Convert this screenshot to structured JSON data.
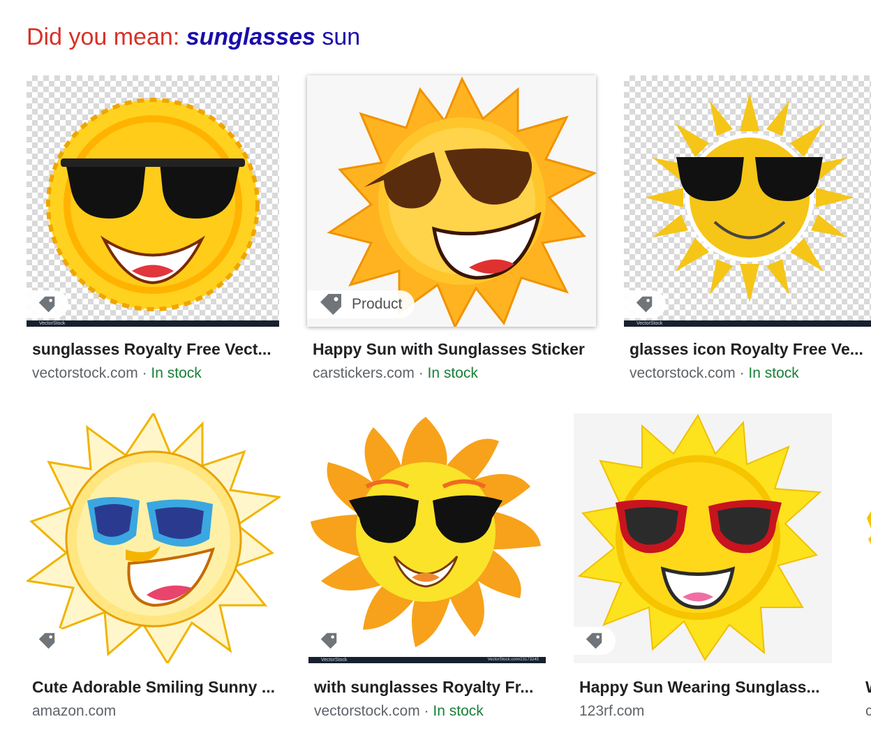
{
  "did_you_mean": {
    "label": "Did you mean:",
    "suggestion_strong": "sunglasses",
    "suggestion_rest": "sun"
  },
  "cards": [
    {
      "title": "sunglasses Royalty Free Vect...",
      "source": "vectorstock.com",
      "separator": "·",
      "stock": "In stock",
      "watermark": "VectorStock"
    },
    {
      "title": "Happy Sun with Sunglasses Sticker",
      "source": "carstickers.com",
      "separator": "·",
      "stock": "In stock",
      "badge": "Product"
    },
    {
      "title": "glasses icon Royalty Free Ve...",
      "source": "vectorstock.com",
      "separator": "·",
      "stock": "In stock",
      "watermark": "VectorStock"
    },
    {
      "title": "Cute Adorable Smiling Sunny ...",
      "source": "amazon.com"
    },
    {
      "title": "with sunglasses Royalty Fr...",
      "source": "vectorstock.com",
      "separator": "·",
      "stock": "In stock",
      "watermark": "VectorStock",
      "watermark_right": "VectorStock.com/23173245"
    },
    {
      "title": "Happy Sun Wearing Sunglass...",
      "source": "123rf.com"
    },
    {
      "title": "W",
      "source": "c"
    }
  ],
  "colors": {
    "suggestion_label": "#d93025",
    "link": "#1a0dab",
    "in_stock": "#188038",
    "title": "#202124",
    "source": "#5f6368"
  },
  "icons": [
    "tag-icon",
    "sun-image"
  ]
}
